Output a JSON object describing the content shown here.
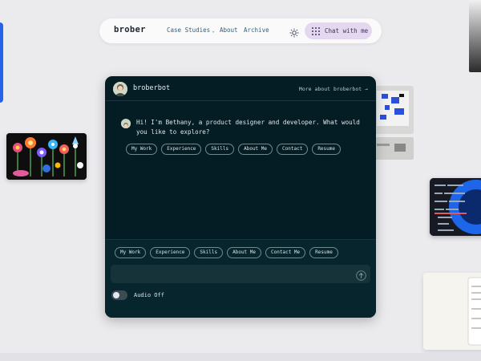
{
  "nav": {
    "brand": "brober",
    "links": [
      {
        "label": "Case Studies",
        "has_dropdown": true
      },
      {
        "label": "About"
      },
      {
        "label": "Archive"
      }
    ],
    "theme_icon": "sun-icon",
    "chat_button_label": "Chat with me",
    "chat_button_icon": "grid-icon",
    "chevron": "⌄"
  },
  "chat": {
    "bot_name": "broberbot",
    "more_link": "More about broberbot →",
    "message": "Hi! I'm Bethany, a product designer and developer. What would you like to explore?",
    "suggestions": [
      "My Work",
      "Experience",
      "Skills",
      "About Me",
      "Contact",
      "Resume"
    ],
    "quick_actions": [
      "My Work",
      "Experience",
      "Skills",
      "About Me",
      "Contact Me",
      "Resume"
    ],
    "input": {
      "value": "",
      "placeholder": ""
    },
    "audio_label": "Audio Off",
    "audio_on": false
  },
  "colors": {
    "page_bg": "#ebebee",
    "chat_bg": "#041d24",
    "chat_button_bg": "#e3d8ef",
    "nav_link": "#33607a",
    "accent_blue": "#2563eb"
  }
}
